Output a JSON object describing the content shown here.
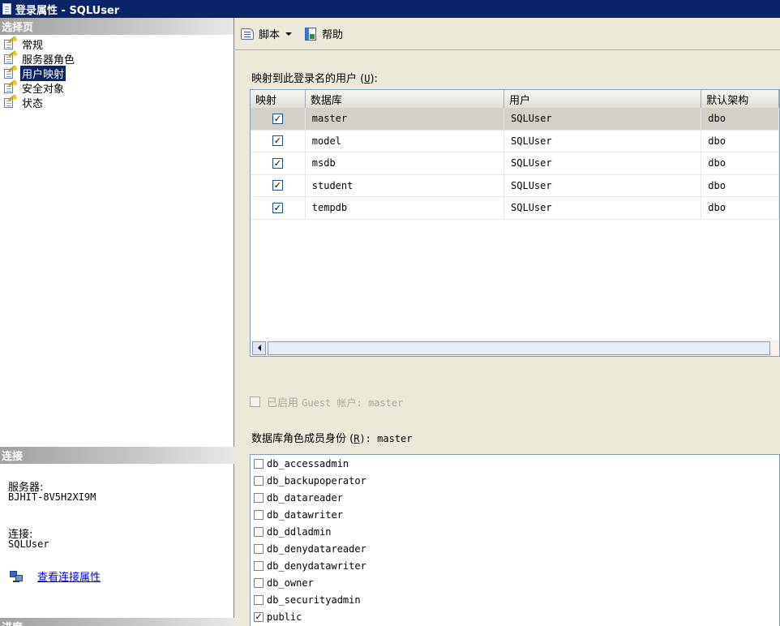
{
  "window": {
    "title": "登录属性 - SQLUser"
  },
  "left": {
    "select_page_header": "选择页",
    "pages": [
      {
        "label": "常规"
      },
      {
        "label": "服务器角色"
      },
      {
        "label": "用户映射",
        "selected": true
      },
      {
        "label": "安全对象"
      },
      {
        "label": "状态"
      }
    ],
    "connection_header": "连接",
    "server_label": "服务器:",
    "server_value": "BJHIT-8V5H2XI9M",
    "connection_label": "连接:",
    "connection_value": "SQLUser",
    "view_connection_link": "查看连接属性",
    "progress_header": "进度"
  },
  "toolbar": {
    "script_label": "脚本",
    "help_label": "帮助"
  },
  "mapping": {
    "label_prefix": "映射到此登录名的用户 (",
    "label_key": "U",
    "label_suffix": "):",
    "columns": [
      "映射",
      "数据库",
      "用户",
      "默认架构"
    ],
    "rows": [
      {
        "db": "master",
        "user": "SQLUser",
        "schema": "dbo",
        "mapped": true
      },
      {
        "db": "model",
        "user": "SQLUser",
        "schema": "dbo",
        "mapped": true
      },
      {
        "db": "msdb",
        "user": "SQLUser",
        "schema": "dbo",
        "mapped": true
      },
      {
        "db": "student",
        "user": "SQLUser",
        "schema": "dbo",
        "mapped": true
      },
      {
        "db": "tempdb",
        "user": "SQLUser",
        "schema": "dbo",
        "mapped": true
      }
    ]
  },
  "guest": {
    "prefix": "已启用",
    "text": "Guest 帐户: master"
  },
  "roles": {
    "label_prefix": "数据库角色成员身份 (",
    "label_key": "R",
    "label_suffix": "): master",
    "items": [
      {
        "name": "db_accessadmin",
        "checked": false
      },
      {
        "name": "db_backupoperator",
        "checked": false
      },
      {
        "name": "db_datareader",
        "checked": false
      },
      {
        "name": "db_datawriter",
        "checked": false
      },
      {
        "name": "db_ddladmin",
        "checked": false
      },
      {
        "name": "db_denydatareader",
        "checked": false
      },
      {
        "name": "db_denydatawriter",
        "checked": false
      },
      {
        "name": "db_owner",
        "checked": false
      },
      {
        "name": "db_securityadmin",
        "checked": false
      },
      {
        "name": "public",
        "checked": true
      }
    ]
  }
}
